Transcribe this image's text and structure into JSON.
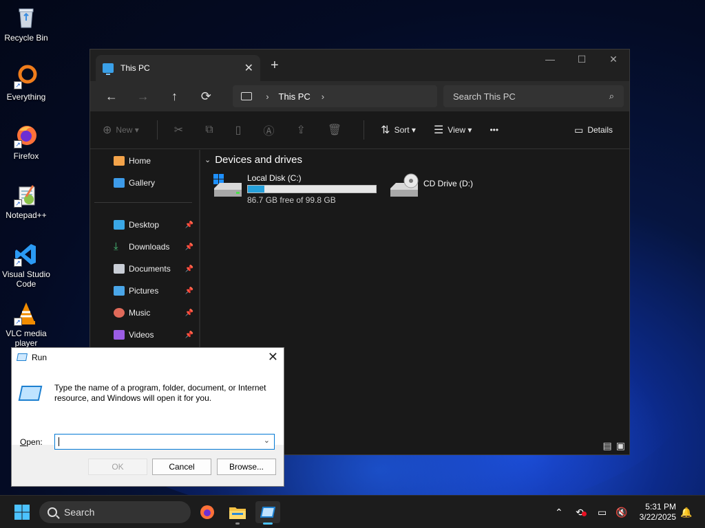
{
  "desktop": {
    "icons": [
      {
        "label": "Recycle Bin"
      },
      {
        "label": "Everything"
      },
      {
        "label": "Firefox"
      },
      {
        "label": "Notepad++"
      },
      {
        "label": "Visual Studio Code"
      },
      {
        "label": "VLC media player"
      }
    ]
  },
  "explorer": {
    "tab_title": "This PC",
    "new_tab": "+",
    "address_crumb": "This PC",
    "search_placeholder": "Search This PC",
    "commands": {
      "new": "New",
      "sort": "Sort",
      "view": "View",
      "more": "•••",
      "details": "Details"
    },
    "sidebar": {
      "top": [
        {
          "label": "Home"
        },
        {
          "label": "Gallery"
        }
      ],
      "pinned": [
        {
          "label": "Desktop"
        },
        {
          "label": "Downloads"
        },
        {
          "label": "Documents"
        },
        {
          "label": "Pictures"
        },
        {
          "label": "Music"
        },
        {
          "label": "Videos"
        }
      ]
    },
    "group_title": "Devices and drives",
    "drives": [
      {
        "name": "Local Disk (C:)",
        "free_text": "86.7 GB free of 99.8 GB",
        "used_fraction": 0.131
      },
      {
        "name": "CD Drive (D:)"
      }
    ]
  },
  "run_dialog": {
    "title": "Run",
    "description": "Type the name of a program, folder, document, or Internet resource, and Windows will open it for you.",
    "open_label": "Open:",
    "open_value": "",
    "ok_label": "OK",
    "cancel_label": "Cancel",
    "browse_label": "Browse..."
  },
  "taskbar": {
    "search_label": "Search",
    "time": "5:31 PM",
    "date": "3/22/2025"
  },
  "colors": {
    "accent": "#0078d4",
    "progress": "#26a0da",
    "dark_bg": "#191919"
  }
}
